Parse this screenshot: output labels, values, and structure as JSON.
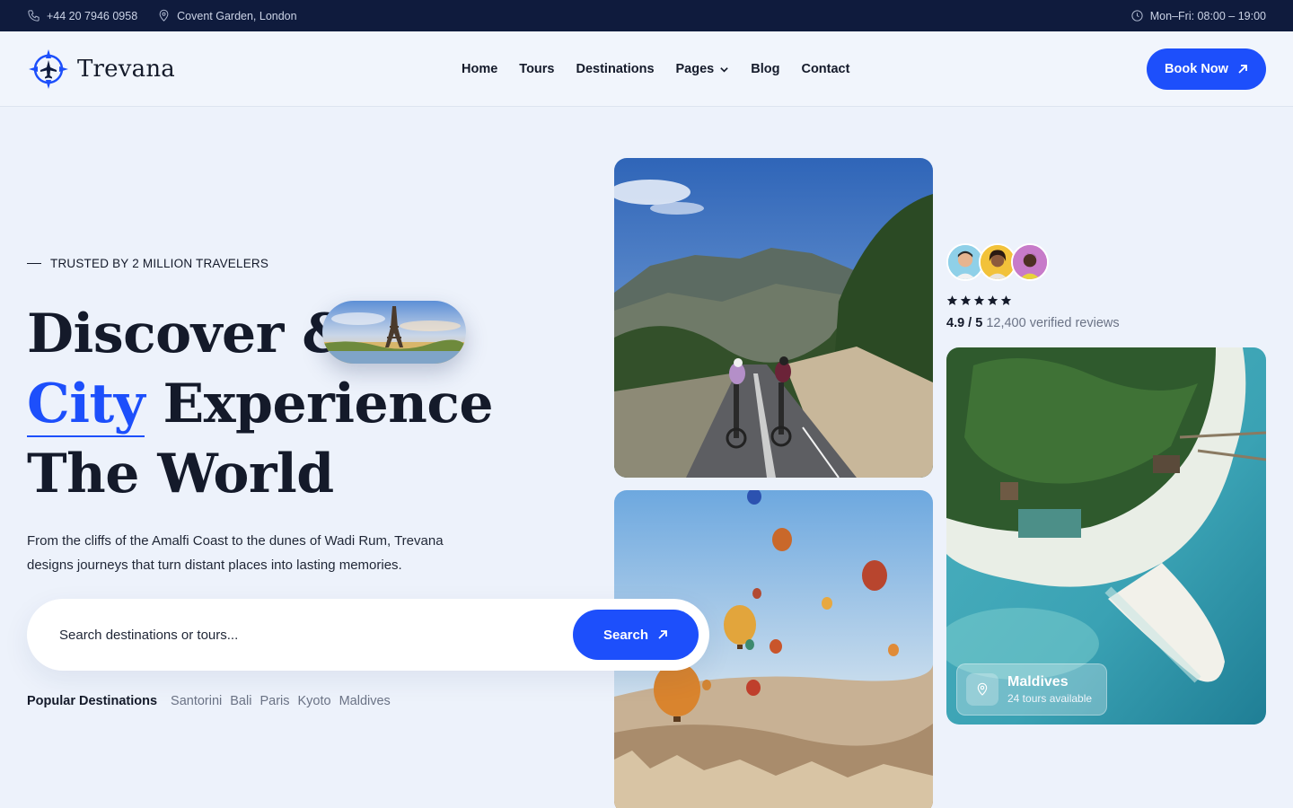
{
  "topbar": {
    "phone": "+44 20 7946 0958",
    "address": "Covent Garden, London",
    "hours": "Mon–Fri: 08:00 – 19:00"
  },
  "brand": {
    "name": "Trevana",
    "accent": "#1d4ffb",
    "dark": "#0f1b3d"
  },
  "nav": {
    "items": [
      {
        "label": "Home"
      },
      {
        "label": "Tours"
      },
      {
        "label": "Destinations"
      },
      {
        "label": "Pages"
      },
      {
        "label": "Blog"
      },
      {
        "label": "Contact"
      }
    ],
    "cta": "Book Now"
  },
  "hero": {
    "eyebrow": "TRUSTED BY 2 MILLION TRAVELERS",
    "headline": {
      "line1": "Discover &",
      "accent": "City",
      "line2_rest": " Experience",
      "line3": "The World"
    },
    "description": "From the cliffs of the Amalfi Coast to the dunes of Wadi Rum, Trevana designs journeys that turn distant places into lasting memories.",
    "search": {
      "placeholder": "Search destinations or tours...",
      "button": "Search"
    },
    "popular": {
      "label": "Popular Destinations",
      "items": [
        "Santorini",
        "Bali",
        "Paris",
        "Kyoto",
        "Maldives"
      ]
    }
  },
  "reviews": {
    "stars": 5,
    "score": "4.9 / 5",
    "count": "12,400 verified reviews"
  },
  "location_card": {
    "title": "Maldives",
    "subtitle": "24 tours available"
  }
}
